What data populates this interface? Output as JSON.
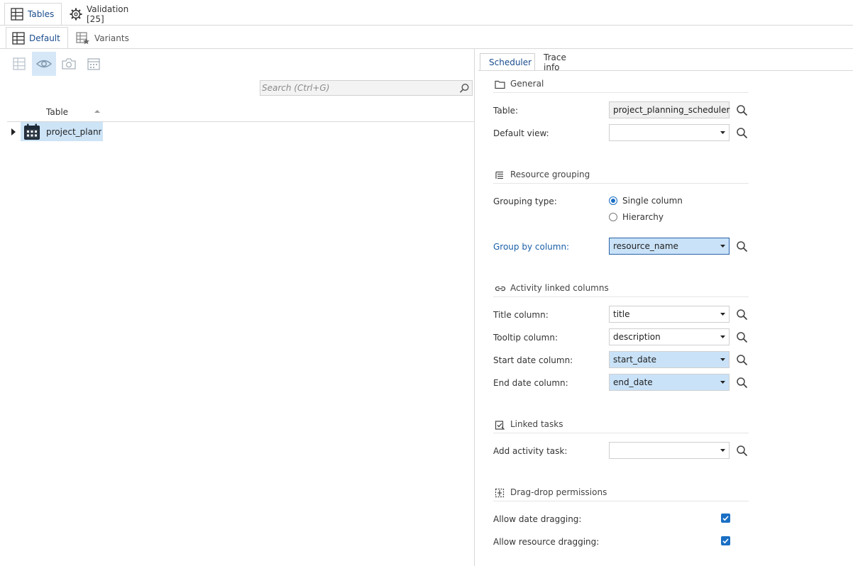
{
  "top_tabs": [
    {
      "label": "Tables",
      "icon": "table-icon",
      "active": true
    },
    {
      "label": "Validation [25]",
      "icon": "validation-gear-icon",
      "active": false
    }
  ],
  "sub_tabs": [
    {
      "label": "Default",
      "icon": "table-icon",
      "active": true
    },
    {
      "label": "Variants",
      "icon": "table-star-icon",
      "active": false
    }
  ],
  "toolbar": {
    "buttons": [
      {
        "icon": "grid-icon",
        "active": false
      },
      {
        "icon": "eye-icon",
        "active": true
      },
      {
        "icon": "camera-icon",
        "active": false
      },
      {
        "icon": "calendar-table-icon",
        "active": false
      }
    ]
  },
  "search": {
    "placeholder": "Search (Ctrl+G)",
    "value": ""
  },
  "table_list": {
    "column_header": "Table",
    "rows": [
      {
        "label": "project_planni",
        "icon": "calendar-icon",
        "selected": true
      }
    ]
  },
  "right_tabs": [
    {
      "label": "Scheduler",
      "active": true
    },
    {
      "label": "Trace info",
      "active": false
    }
  ],
  "general": {
    "title": "General",
    "table_label": "Table:",
    "table_value": "project_planning_scheduler",
    "default_view_label": "Default view:",
    "default_view_value": ""
  },
  "resource_grouping": {
    "title": "Resource grouping",
    "grouping_type_label": "Grouping type:",
    "options": [
      {
        "label": "Single column",
        "selected": true
      },
      {
        "label": "Hierarchy",
        "selected": false
      }
    ],
    "group_by_label": "Group by column:",
    "group_by_value": "resource_name"
  },
  "activity_columns": {
    "title": "Activity linked columns",
    "title_col_label": "Title column:",
    "title_col_value": "title",
    "tooltip_col_label": "Tooltip column:",
    "tooltip_col_value": "description",
    "start_col_label": "Start date column:",
    "start_col_value": "start_date",
    "end_col_label": "End date column:",
    "end_col_value": "end_date"
  },
  "linked_tasks": {
    "title": "Linked tasks",
    "add_label": "Add activity task:",
    "add_value": ""
  },
  "drag_drop": {
    "title": "Drag-drop permissions",
    "date_label": "Allow date dragging:",
    "date_checked": true,
    "resource_label": "Allow resource dragging:",
    "resource_checked": true
  },
  "colors": {
    "accent": "#1a6fc4",
    "selection": "#cde4f7",
    "tab_text_active": "#1a4d8f",
    "label_highlight": "#1a5fa8"
  }
}
